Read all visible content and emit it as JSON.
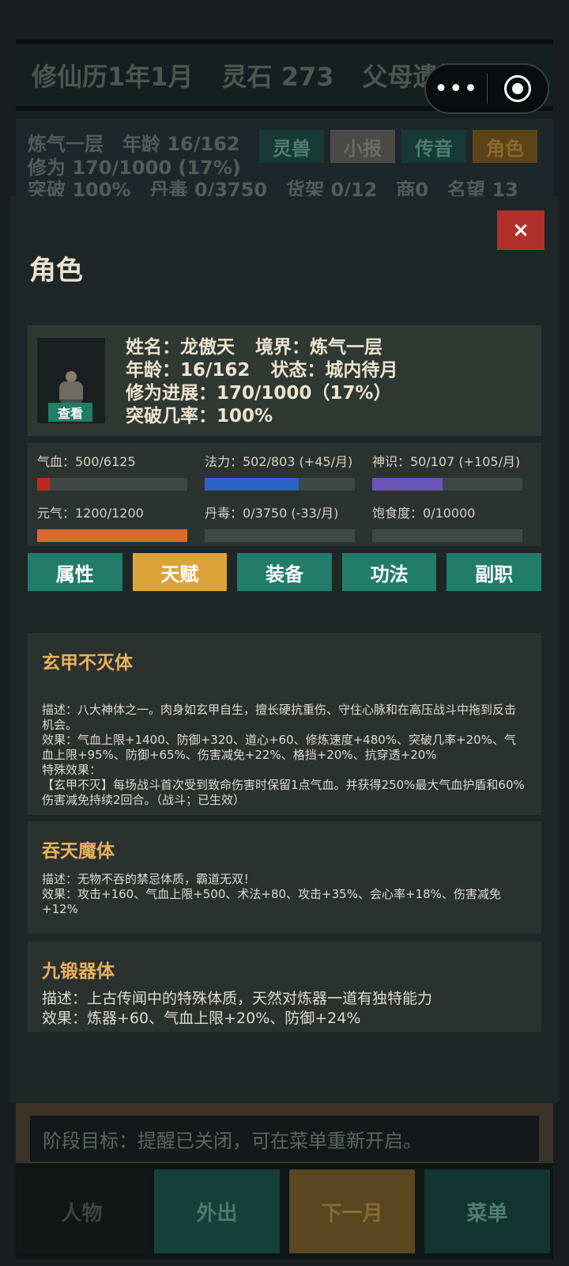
{
  "topbar": {
    "date": "修仙历1年1月",
    "spirit_stones": "灵石 273",
    "event": "父母遗摊"
  },
  "capsule": {
    "more": "•••"
  },
  "status": {
    "line1": "炼气一层　年龄 16/162",
    "line2": "修为 170/1000 (17%)",
    "line3": "突破 100%　丹毒 0/3750　货架 0/12　商0　名望 13",
    "tags": [
      "灵兽",
      "小报",
      "传音",
      "角色"
    ]
  },
  "modal": {
    "title": "角色",
    "close": "×",
    "profile": {
      "view": "查看",
      "name": "姓名：龙傲天",
      "realm": "境界：炼气一层",
      "age": "年龄：16/162",
      "state": "状态：城内待月",
      "progress": "修为进展：170/1000（17%）",
      "breakthrough": "突破几率：100%"
    },
    "stats": [
      {
        "label": "气血：500/6125",
        "fraction": 0.082,
        "color": "#c0281f"
      },
      {
        "label": "法力：502/803 (+45/月)",
        "fraction": 0.625,
        "color": "#2a62c6"
      },
      {
        "label": "神识：50/107 (+105/月)",
        "fraction": 0.467,
        "color": "#6a55b8"
      },
      {
        "label": "元气：1200/1200",
        "fraction": 1.0,
        "color": "#d86a31"
      },
      {
        "label": "丹毒：0/3750 (-33/月)",
        "fraction": 0.0,
        "color": "#d86a31"
      },
      {
        "label": "饱食度：0/10000",
        "fraction": 0.0,
        "color": "#d86a31"
      }
    ],
    "tabs": [
      "属性",
      "天赋",
      "装备",
      "功法",
      "副职"
    ],
    "active_tab": "天赋",
    "talents": [
      {
        "name": "玄甲不灭体",
        "lines": [
          "描述：八大神体之一。肉身如玄甲自生，擅长硬抗重伤、守住心脉和在高压战斗中拖到反击机会。",
          "效果：气血上限+1400、防御+320、道心+60、修炼速度+480%、突破几率+20%、气血上限+95%、防御+65%、伤害减免+22%、格挡+20%、抗穿透+20%",
          "特殊效果：",
          "【玄甲不灭】每场战斗首次受到致命伤害时保留1点气血。并获得250%最大气血护盾和60%伤害减免持续2回合。（战斗；已生效）"
        ]
      },
      {
        "name": "吞天魔体",
        "lines": [
          "描述：无物不吞的禁忌体质，霸道无双！",
          "效果：攻击+160、气血上限+500、术法+80、攻击+35%、会心率+18%、伤害减免+12%"
        ]
      },
      {
        "name": "九锻器体",
        "lines": [
          "描述：上古传闻中的特殊体质，天然对炼器一道有独特能力",
          "效果：炼器+60、气血上限+20%、防御+24%"
        ]
      }
    ]
  },
  "goal": "阶段目标：提醒已关闭，可在菜单重新开启。",
  "bottom_nav": [
    "人物",
    "外出",
    "下一月",
    "菜单"
  ]
}
